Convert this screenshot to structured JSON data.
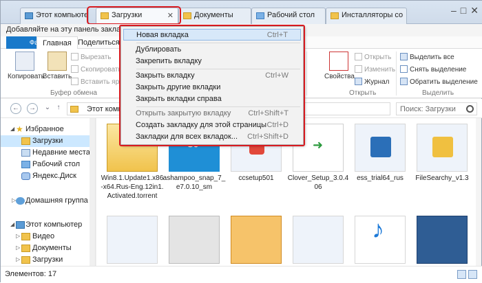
{
  "tabs": [
    {
      "label": "Этот компьютер"
    },
    {
      "label": "Загрузки"
    },
    {
      "label": "Документы"
    },
    {
      "label": "Рабочий стол"
    },
    {
      "label": "Инсталляторы со"
    }
  ],
  "window_controls": {
    "minimize": "–",
    "maximize": "□",
    "close": "✕"
  },
  "favbar": {
    "text": "Добавляйте на эту панель заклад"
  },
  "ribbon_tabs": {
    "file": "Файл",
    "home": "Главная",
    "share": "Поделиться"
  },
  "ribbon": {
    "copy": "Копировать",
    "paste": "Вставить",
    "cut": "Вырезать",
    "copy_path": "Скопировать пут",
    "paste_shortcut": "Вставить ярлы",
    "clipboard_group": "Буфер обмена",
    "properties": "Свойства",
    "open": "Открыть",
    "edit": "Изменить",
    "journal": "Журнал",
    "open_group": "Открыть",
    "select_all": "Выделить все",
    "select_none": "Снять выделение",
    "invert_selection": "Обратить выделение",
    "select_group": "Выделить"
  },
  "address": {
    "path_segment": "Этот компь",
    "search_placeholder": "Поиск: Загрузки",
    "back": "←",
    "forward": "→",
    "history": "⌄",
    "up": "↑"
  },
  "nav": {
    "favorites": "Избранное",
    "downloads": "Загрузки",
    "recent": "Недавние места",
    "desktop": "Рабочий стол",
    "yandex": "Яндекс.Диск",
    "homegroup": "Домашняя группа",
    "this_pc": "Этот компьютер",
    "video": "Видео",
    "documents": "Документы",
    "downloads2": "Загрузки"
  },
  "files": [
    {
      "name": "Win8.1.Update1.x86-x64.Rus-Eng.12in1.Activated.torrent"
    },
    {
      "name": "ashampoo_snap_7_e7.0.10_sm"
    },
    {
      "name": "ccsetup501"
    },
    {
      "name": "Clover_Setup_3.0.406"
    },
    {
      "name": "ess_trial64_rus"
    },
    {
      "name": "FileSearchy_v1.3"
    }
  ],
  "status": {
    "items_count": "Элементов: 17"
  },
  "context_menu": {
    "new_tab": {
      "label": "Новая вкладка",
      "shortcut": "Ctrl+T"
    },
    "duplicate": {
      "label": "Дублировать"
    },
    "pin": {
      "label": "Закрепить вкладку"
    },
    "close_tab": {
      "label": "Закрыть вкладку",
      "shortcut": "Ctrl+W"
    },
    "close_others": {
      "label": "Закрыть другие вкладки"
    },
    "close_right": {
      "label": "Закрыть вкладки справа"
    },
    "reopen": {
      "label": "Открыть закрытую вкладку",
      "shortcut": "Ctrl+Shift+T"
    },
    "bookmark_page": {
      "label": "Создать закладку для этой страницы",
      "shortcut": "Ctrl+D"
    },
    "bookmark_all": {
      "label": "Закладки для всех вкладок...",
      "shortcut": "Ctrl+Shift+D"
    }
  },
  "colors": {
    "highlight": "#d8191f",
    "accent": "#1979ca",
    "selection": "#cce8ff"
  }
}
